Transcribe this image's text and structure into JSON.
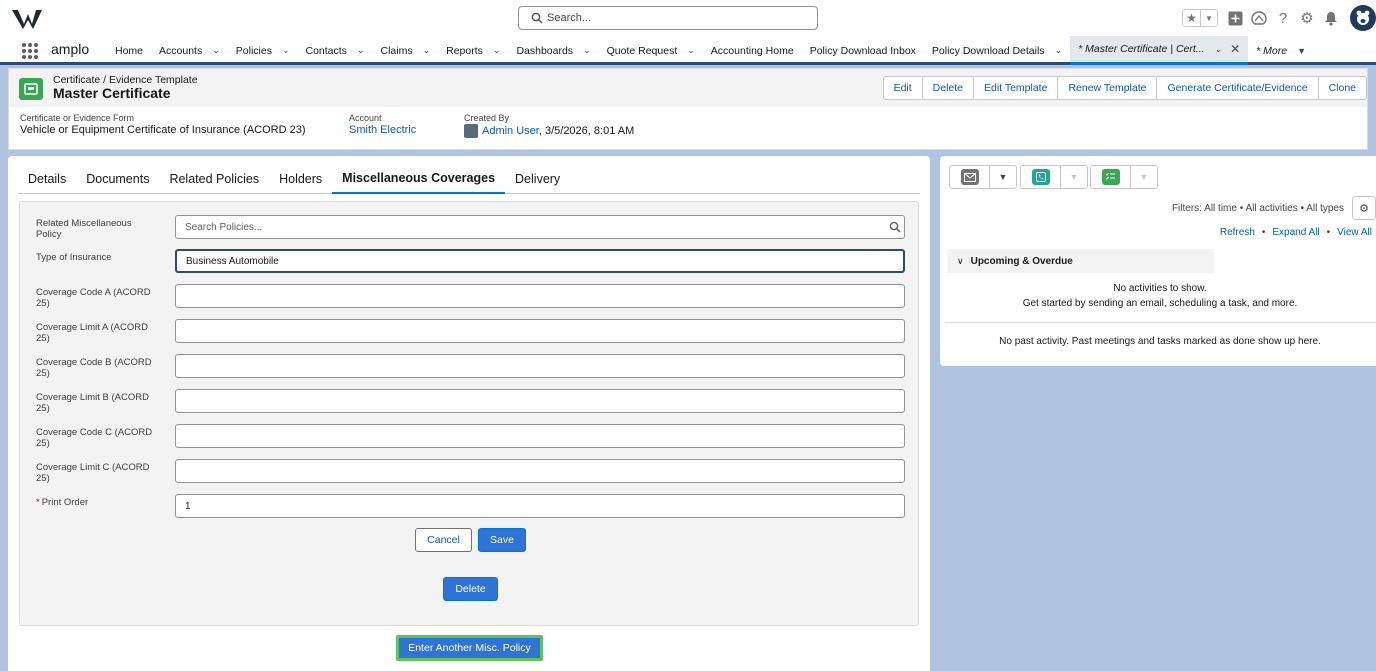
{
  "header": {
    "search_placeholder": "Search...",
    "icons": [
      "favorites-star-icon",
      "chevron-down-icon",
      "add-icon",
      "trailhead-icon",
      "help-icon",
      "gear-icon",
      "bell-icon",
      "avatar"
    ]
  },
  "nav": {
    "app_name": "amplo",
    "items": [
      {
        "label": "Home",
        "chevron": false
      },
      {
        "label": "Accounts",
        "chevron": true
      },
      {
        "label": "Policies",
        "chevron": true
      },
      {
        "label": "Contacts",
        "chevron": true
      },
      {
        "label": "Claims",
        "chevron": true
      },
      {
        "label": "Reports",
        "chevron": true
      },
      {
        "label": "Dashboards",
        "chevron": true
      },
      {
        "label": "Quote Request",
        "chevron": true
      },
      {
        "label": "Accounting Home",
        "chevron": false
      },
      {
        "label": "Policy Download Inbox",
        "chevron": false
      },
      {
        "label": "Policy Download Details",
        "chevron": true
      }
    ],
    "active_tab": "* Master Certificate | Cert...",
    "more_label": "* More"
  },
  "record": {
    "type_label": "Certificate / Evidence Template",
    "title": "Master Certificate",
    "actions": [
      "Edit",
      "Delete",
      "Edit Template",
      "Renew Template",
      "Generate Certificate/Evidence",
      "Clone"
    ],
    "highlights": {
      "form_label": "Certificate or Evidence Form",
      "form_value": "Vehicle or Equipment Certificate of Insurance (ACORD 23)",
      "account_label": "Account",
      "account_value": "Smith Electric",
      "created_label": "Created By",
      "created_user": "Admin User",
      "created_date": ", 3/5/2026, 8:01 AM"
    }
  },
  "tabs": [
    "Details",
    "Documents",
    "Related Policies",
    "Holders",
    "Miscellaneous Coverages",
    "Delivery"
  ],
  "active_tab_index": 4,
  "form": {
    "related_policy_label": "Related Miscellaneous Policy",
    "related_policy_placeholder": "Search Policies...",
    "type_label": "Type of Insurance",
    "type_value": "Business Automobile",
    "code_a_label": "Coverage Code A (ACORD 25)",
    "limit_a_label": "Coverage Limit A (ACORD 25)",
    "code_b_label": "Coverage Code B (ACORD 25)",
    "limit_b_label": "Coverage Limit B (ACORD 25)",
    "code_c_label": "Coverage Code C (ACORD 25)",
    "limit_c_label": "Coverage Limit C (ACORD 25)",
    "print_order_label": "Print Order",
    "required_mark": "*",
    "print_order_value": "1",
    "cancel_label": "Cancel",
    "save_label": "Save",
    "delete_label": "Delete",
    "another_label": "Enter Another Misc. Policy"
  },
  "activity": {
    "filters": "Filters: All time • All activities • All types",
    "refresh": "Refresh",
    "expand_all": "Expand All",
    "view_all": "View All",
    "separator": "•",
    "upcoming": "Upcoming & Overdue",
    "no_activities": "No activities to show.",
    "get_started": "Get started by sending an email, scheduling a task, and more.",
    "no_past": "No past activity. Past meetings and tasks marked as done show up here."
  },
  "colors": {
    "nav_underline": "#2b4d73",
    "active_tab": "#0176d3",
    "brand_button": "#2e74d6",
    "record_icon": "#3ba755",
    "link": "#0b5cab",
    "page_background": "#b0c4df"
  }
}
